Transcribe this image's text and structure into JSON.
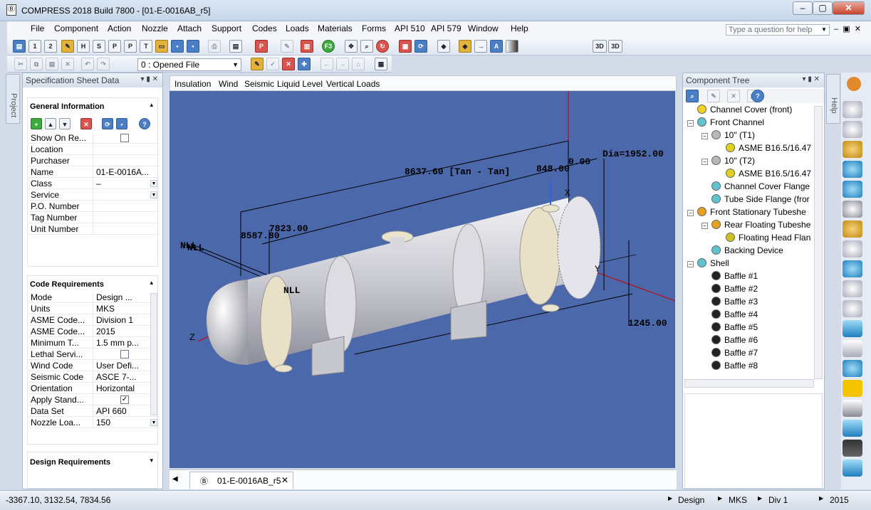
{
  "window": {
    "title": "COMPRESS 2018 Build 7800 - [01-E-0016AB_r5]",
    "min": "–",
    "max": "▢",
    "close": "✕"
  },
  "menu": [
    "File",
    "Component",
    "Action",
    "Nozzle",
    "Attach",
    "Support",
    "Codes",
    "Loads",
    "Materials",
    "Forms",
    "API 510",
    "API 579",
    "Window",
    "Help"
  ],
  "help_box": {
    "placeholder": "Type a question for help"
  },
  "toolbar2": {
    "open_file": "0 : Opened File"
  },
  "toolbar3d": {
    "btn_a": "3D",
    "btn_b": "3D"
  },
  "left_panel": {
    "title": "Specification Sheet Data",
    "side_tab": "Project",
    "general": {
      "header": "General Information",
      "rows": [
        {
          "k": "Show On Re...",
          "v": "",
          "chk": true
        },
        {
          "k": "Location",
          "v": ""
        },
        {
          "k": "Purchaser",
          "v": ""
        },
        {
          "k": "Name",
          "v": "01-E-0016A..."
        },
        {
          "k": "Class",
          "v": "–",
          "dd": true
        },
        {
          "k": "Service",
          "v": "",
          "dd": true
        },
        {
          "k": "P.O. Number",
          "v": ""
        },
        {
          "k": "Tag Number",
          "v": ""
        },
        {
          "k": "Unit Number",
          "v": ""
        }
      ]
    },
    "code": {
      "header": "Code Requirements",
      "rows": [
        {
          "k": "Mode",
          "v": "Design ...",
          "dd": true
        },
        {
          "k": "Units",
          "v": "MKS",
          "dd": true
        },
        {
          "k": "ASME Code...",
          "v": "Division 1",
          "dd": true
        },
        {
          "k": "ASME Code...",
          "v": "2015",
          "dd": true
        },
        {
          "k": "Minimum T...",
          "v": "1.5 mm p...",
          "dd": true
        },
        {
          "k": "Lethal Servi...",
          "v": "",
          "chk": true
        },
        {
          "k": "Wind Code",
          "v": "User Defi...",
          "dd": true
        },
        {
          "k": "Seismic Code",
          "v": "ASCE 7-...",
          "dd": true
        },
        {
          "k": "Orientation",
          "v": "Horizontal",
          "dd": true
        },
        {
          "k": "Apply Stand...",
          "v": "",
          "chk": true,
          "checked": "✓"
        },
        {
          "k": "Data Set",
          "v": "API 660",
          "dd": true
        },
        {
          "k": "Nozzle Loa...",
          "v": "150",
          "dd": true
        }
      ]
    },
    "design": {
      "header": "Design Requirements"
    }
  },
  "viewport": {
    "tabs": [
      "Insulation",
      "Wind",
      "Seismic",
      "Liquid Level",
      "Vertical Loads"
    ],
    "dims": {
      "tan": "8637.60 [Tan - Tan]",
      "d1": "848.00",
      "d2": "0.00",
      "dia": "Dia=1952.00",
      "d3": "7823.00",
      "d4": "8587.80",
      "d5": "1245.00",
      "nll1": "NLL",
      "nll2": "NLL",
      "nll3": "NLL"
    },
    "axes": {
      "x": "X",
      "y": "Y",
      "z": "Z"
    },
    "doc_tab": "01-E-0016AB_r5"
  },
  "tree_panel": {
    "title": "Component Tree",
    "side_tab": "Help",
    "nodes": [
      {
        "label": "Channel Cover (front)",
        "color": "#f0d020"
      },
      {
        "label": "Front Channel",
        "color": "#60c4d0"
      },
      {
        "label": "10\" (T1)",
        "color": "#b8b8b8"
      },
      {
        "label": "ASME B16.5/16.47",
        "color": "#e0d020"
      },
      {
        "label": "10\" (T2)",
        "color": "#b8b8b8"
      },
      {
        "label": "ASME B16.5/16.47",
        "color": "#e0d020"
      },
      {
        "label": "Channel Cover Flange",
        "color": "#60c4d0"
      },
      {
        "label": "Tube Side Flange (fror",
        "color": "#60c4d0"
      },
      {
        "label": "Front Stationary Tubeshe",
        "color": "#e8a020"
      },
      {
        "label": "Rear Floating Tubeshe",
        "color": "#e8a020"
      },
      {
        "label": "Floating Head Flan",
        "color": "#d0c020"
      },
      {
        "label": "Backing Device",
        "color": "#60c4d0"
      },
      {
        "label": "Shell",
        "color": "#60c4d0"
      },
      {
        "label": "Baffle #1",
        "color": "#222"
      },
      {
        "label": "Baffle #2",
        "color": "#222"
      },
      {
        "label": "Baffle #3",
        "color": "#222"
      },
      {
        "label": "Baffle #4",
        "color": "#222"
      },
      {
        "label": "Baffle #5",
        "color": "#222"
      },
      {
        "label": "Baffle #6",
        "color": "#222"
      },
      {
        "label": "Baffle #7",
        "color": "#222"
      },
      {
        "label": "Baffle #8",
        "color": "#222"
      }
    ]
  },
  "status": {
    "coords": "-3367.10, 3132.54, 7834.56",
    "mode": "Design",
    "units": "MKS",
    "div": "Div 1",
    "year": "2015"
  }
}
